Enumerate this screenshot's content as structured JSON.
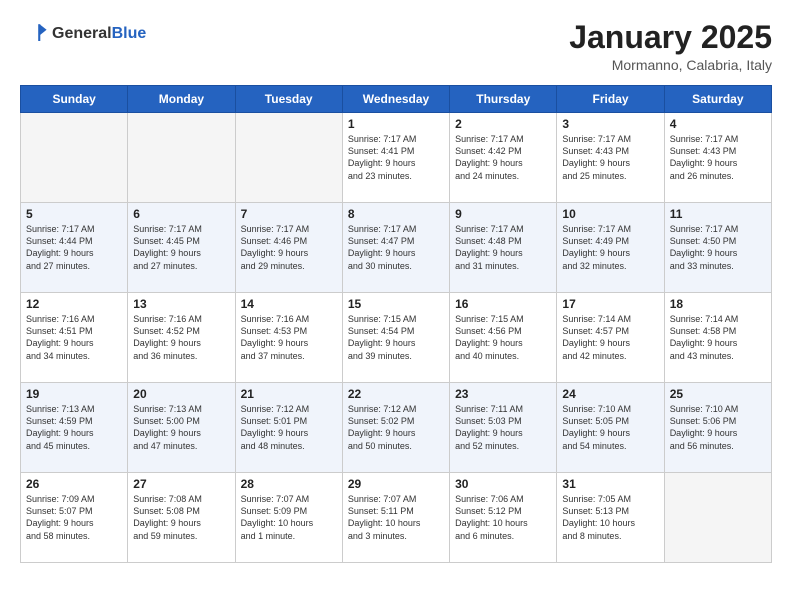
{
  "header": {
    "logo_general": "General",
    "logo_blue": "Blue",
    "month_title": "January 2025",
    "location": "Mormanno, Calabria, Italy"
  },
  "days_of_week": [
    "Sunday",
    "Monday",
    "Tuesday",
    "Wednesday",
    "Thursday",
    "Friday",
    "Saturday"
  ],
  "weeks": [
    [
      {
        "day": "",
        "info": ""
      },
      {
        "day": "",
        "info": ""
      },
      {
        "day": "",
        "info": ""
      },
      {
        "day": "1",
        "info": "Sunrise: 7:17 AM\nSunset: 4:41 PM\nDaylight: 9 hours\nand 23 minutes."
      },
      {
        "day": "2",
        "info": "Sunrise: 7:17 AM\nSunset: 4:42 PM\nDaylight: 9 hours\nand 24 minutes."
      },
      {
        "day": "3",
        "info": "Sunrise: 7:17 AM\nSunset: 4:43 PM\nDaylight: 9 hours\nand 25 minutes."
      },
      {
        "day": "4",
        "info": "Sunrise: 7:17 AM\nSunset: 4:43 PM\nDaylight: 9 hours\nand 26 minutes."
      }
    ],
    [
      {
        "day": "5",
        "info": "Sunrise: 7:17 AM\nSunset: 4:44 PM\nDaylight: 9 hours\nand 27 minutes."
      },
      {
        "day": "6",
        "info": "Sunrise: 7:17 AM\nSunset: 4:45 PM\nDaylight: 9 hours\nand 27 minutes."
      },
      {
        "day": "7",
        "info": "Sunrise: 7:17 AM\nSunset: 4:46 PM\nDaylight: 9 hours\nand 29 minutes."
      },
      {
        "day": "8",
        "info": "Sunrise: 7:17 AM\nSunset: 4:47 PM\nDaylight: 9 hours\nand 30 minutes."
      },
      {
        "day": "9",
        "info": "Sunrise: 7:17 AM\nSunset: 4:48 PM\nDaylight: 9 hours\nand 31 minutes."
      },
      {
        "day": "10",
        "info": "Sunrise: 7:17 AM\nSunset: 4:49 PM\nDaylight: 9 hours\nand 32 minutes."
      },
      {
        "day": "11",
        "info": "Sunrise: 7:17 AM\nSunset: 4:50 PM\nDaylight: 9 hours\nand 33 minutes."
      }
    ],
    [
      {
        "day": "12",
        "info": "Sunrise: 7:16 AM\nSunset: 4:51 PM\nDaylight: 9 hours\nand 34 minutes."
      },
      {
        "day": "13",
        "info": "Sunrise: 7:16 AM\nSunset: 4:52 PM\nDaylight: 9 hours\nand 36 minutes."
      },
      {
        "day": "14",
        "info": "Sunrise: 7:16 AM\nSunset: 4:53 PM\nDaylight: 9 hours\nand 37 minutes."
      },
      {
        "day": "15",
        "info": "Sunrise: 7:15 AM\nSunset: 4:54 PM\nDaylight: 9 hours\nand 39 minutes."
      },
      {
        "day": "16",
        "info": "Sunrise: 7:15 AM\nSunset: 4:56 PM\nDaylight: 9 hours\nand 40 minutes."
      },
      {
        "day": "17",
        "info": "Sunrise: 7:14 AM\nSunset: 4:57 PM\nDaylight: 9 hours\nand 42 minutes."
      },
      {
        "day": "18",
        "info": "Sunrise: 7:14 AM\nSunset: 4:58 PM\nDaylight: 9 hours\nand 43 minutes."
      }
    ],
    [
      {
        "day": "19",
        "info": "Sunrise: 7:13 AM\nSunset: 4:59 PM\nDaylight: 9 hours\nand 45 minutes."
      },
      {
        "day": "20",
        "info": "Sunrise: 7:13 AM\nSunset: 5:00 PM\nDaylight: 9 hours\nand 47 minutes."
      },
      {
        "day": "21",
        "info": "Sunrise: 7:12 AM\nSunset: 5:01 PM\nDaylight: 9 hours\nand 48 minutes."
      },
      {
        "day": "22",
        "info": "Sunrise: 7:12 AM\nSunset: 5:02 PM\nDaylight: 9 hours\nand 50 minutes."
      },
      {
        "day": "23",
        "info": "Sunrise: 7:11 AM\nSunset: 5:03 PM\nDaylight: 9 hours\nand 52 minutes."
      },
      {
        "day": "24",
        "info": "Sunrise: 7:10 AM\nSunset: 5:05 PM\nDaylight: 9 hours\nand 54 minutes."
      },
      {
        "day": "25",
        "info": "Sunrise: 7:10 AM\nSunset: 5:06 PM\nDaylight: 9 hours\nand 56 minutes."
      }
    ],
    [
      {
        "day": "26",
        "info": "Sunrise: 7:09 AM\nSunset: 5:07 PM\nDaylight: 9 hours\nand 58 minutes."
      },
      {
        "day": "27",
        "info": "Sunrise: 7:08 AM\nSunset: 5:08 PM\nDaylight: 9 hours\nand 59 minutes."
      },
      {
        "day": "28",
        "info": "Sunrise: 7:07 AM\nSunset: 5:09 PM\nDaylight: 10 hours\nand 1 minute."
      },
      {
        "day": "29",
        "info": "Sunrise: 7:07 AM\nSunset: 5:11 PM\nDaylight: 10 hours\nand 3 minutes."
      },
      {
        "day": "30",
        "info": "Sunrise: 7:06 AM\nSunset: 5:12 PM\nDaylight: 10 hours\nand 6 minutes."
      },
      {
        "day": "31",
        "info": "Sunrise: 7:05 AM\nSunset: 5:13 PM\nDaylight: 10 hours\nand 8 minutes."
      },
      {
        "day": "",
        "info": ""
      }
    ]
  ]
}
